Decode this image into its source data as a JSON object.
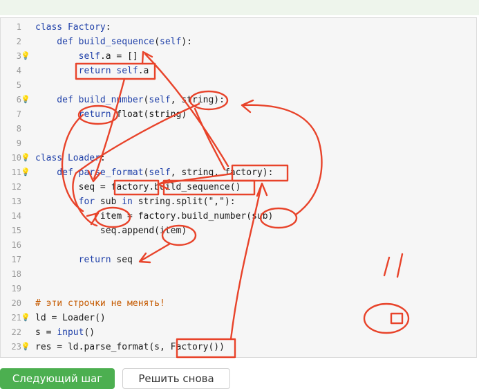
{
  "editor": {
    "lines": [
      {
        "num": "1",
        "bulb": false,
        "segments": [
          {
            "t": "class ",
            "c": "kw"
          },
          {
            "t": "Factory",
            "c": "fn"
          },
          {
            "t": ":",
            "c": ""
          }
        ]
      },
      {
        "num": "2",
        "bulb": false,
        "segments": [
          {
            "t": "    def ",
            "c": "kw"
          },
          {
            "t": "build_sequence",
            "c": "fn"
          },
          {
            "t": "(",
            "c": ""
          },
          {
            "t": "self",
            "c": "kw"
          },
          {
            "t": "):",
            "c": ""
          }
        ]
      },
      {
        "num": "3",
        "bulb": true,
        "segments": [
          {
            "t": "        ",
            "c": ""
          },
          {
            "t": "self",
            "c": "kw"
          },
          {
            "t": ".a = []",
            "c": ""
          }
        ]
      },
      {
        "num": "4",
        "bulb": false,
        "segments": [
          {
            "t": "        return ",
            "c": "kw"
          },
          {
            "t": "self",
            "c": "kw"
          },
          {
            "t": ".a",
            "c": ""
          }
        ]
      },
      {
        "num": "5",
        "bulb": false,
        "segments": []
      },
      {
        "num": "6",
        "bulb": true,
        "segments": [
          {
            "t": "    def ",
            "c": "kw"
          },
          {
            "t": "build_number",
            "c": "fn"
          },
          {
            "t": "(",
            "c": ""
          },
          {
            "t": "self",
            "c": "kw"
          },
          {
            "t": ", string):",
            "c": ""
          }
        ]
      },
      {
        "num": "7",
        "bulb": false,
        "segments": [
          {
            "t": "        return ",
            "c": "kw"
          },
          {
            "t": "float",
            "c": ""
          },
          {
            "t": "(string)",
            "c": ""
          }
        ]
      },
      {
        "num": "8",
        "bulb": false,
        "segments": []
      },
      {
        "num": "9",
        "bulb": false,
        "segments": []
      },
      {
        "num": "10",
        "bulb": true,
        "segments": [
          {
            "t": "class ",
            "c": "kw"
          },
          {
            "t": "Loader",
            "c": "fn"
          },
          {
            "t": ":",
            "c": ""
          }
        ]
      },
      {
        "num": "11",
        "bulb": true,
        "segments": [
          {
            "t": "    def ",
            "c": "kw"
          },
          {
            "t": "parse_format",
            "c": "fn"
          },
          {
            "t": "(",
            "c": ""
          },
          {
            "t": "self",
            "c": "kw"
          },
          {
            "t": ", string, factory):",
            "c": ""
          }
        ]
      },
      {
        "num": "12",
        "bulb": false,
        "segments": [
          {
            "t": "        seq = factory.build_sequence()",
            "c": ""
          }
        ]
      },
      {
        "num": "13",
        "bulb": false,
        "segments": [
          {
            "t": "        for ",
            "c": "kw"
          },
          {
            "t": "sub ",
            "c": ""
          },
          {
            "t": "in ",
            "c": "kw"
          },
          {
            "t": "string.split(\",\"):",
            "c": ""
          }
        ]
      },
      {
        "num": "14",
        "bulb": false,
        "segments": [
          {
            "t": "            item = factory.build_number(sub)",
            "c": ""
          }
        ]
      },
      {
        "num": "15",
        "bulb": false,
        "segments": [
          {
            "t": "            seq.append(item)",
            "c": ""
          }
        ]
      },
      {
        "num": "16",
        "bulb": false,
        "segments": []
      },
      {
        "num": "17",
        "bulb": false,
        "segments": [
          {
            "t": "        return ",
            "c": "kw"
          },
          {
            "t": "seq",
            "c": ""
          }
        ]
      },
      {
        "num": "18",
        "bulb": false,
        "segments": []
      },
      {
        "num": "19",
        "bulb": false,
        "segments": []
      },
      {
        "num": "20",
        "bulb": false,
        "segments": [
          {
            "t": "# эти строчки не менять!",
            "c": "cm"
          }
        ]
      },
      {
        "num": "21",
        "bulb": true,
        "segments": [
          {
            "t": "ld = Loader()",
            "c": ""
          }
        ]
      },
      {
        "num": "22",
        "bulb": false,
        "segments": [
          {
            "t": "s = ",
            "c": ""
          },
          {
            "t": "input",
            "c": "kw"
          },
          {
            "t": "()",
            "c": ""
          }
        ]
      },
      {
        "num": "23",
        "bulb": true,
        "segments": [
          {
            "t": "res = ld.parse_format(s, Factory())",
            "c": ""
          }
        ]
      }
    ]
  },
  "buttons": {
    "next_label": "Следующий шаг",
    "reset_label": "Решить снова"
  },
  "colors": {
    "annotation": "#e8432a",
    "next_button_bg": "#4caf50",
    "keyword": "#1e3fa8",
    "comment": "#c55a00"
  }
}
